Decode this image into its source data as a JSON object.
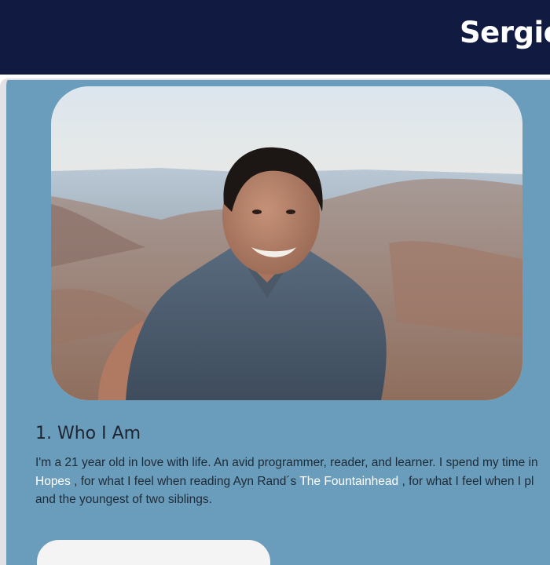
{
  "header": {
    "title": "Sergio"
  },
  "profile": {
    "photo_alt": "Portrait of Sergio smiling outdoors at sunset"
  },
  "about": {
    "heading": "1. Who I Am",
    "line1": "I'm a 21 year old in love with life. An avid programmer, reader, and learner. I spend my time in",
    "link1": "Hopes",
    "mid1": " , for what I feel when reading Ayn Rand´s ",
    "link2": "The Fountainhead",
    "mid2": " , for what I feel when I pl",
    "line3": "and the youngest of two siblings."
  },
  "colors": {
    "header_bg": "#111b42",
    "panel_bg": "#6a9dbb",
    "link": "#ffffff"
  }
}
